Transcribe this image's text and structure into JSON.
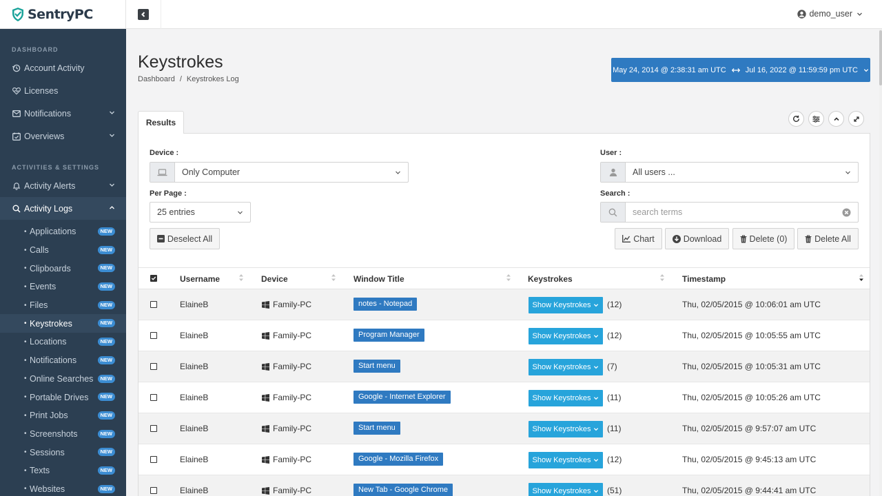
{
  "brand": {
    "name": "SentryPC",
    "shield_color": "#1aa39a"
  },
  "topbar": {
    "username": "demo_user"
  },
  "sidebar": {
    "sections": [
      {
        "heading": "DASHBOARD"
      },
      {
        "heading": "ACTIVITIES & SETTINGS"
      }
    ],
    "items": [
      {
        "label": "Account Activity",
        "icon": "history-icon"
      },
      {
        "label": "Licenses",
        "icon": "heart-pulse-icon"
      },
      {
        "label": "Notifications",
        "icon": "envelope-icon"
      },
      {
        "label": "Overviews",
        "icon": "calendar-check-icon"
      },
      {
        "label": "Activity Alerts",
        "icon": "bell-icon"
      },
      {
        "label": "Activity Logs",
        "icon": "search-icon"
      }
    ],
    "subitems": [
      {
        "label": "Applications",
        "badge": "NEW"
      },
      {
        "label": "Calls",
        "badge": "NEW"
      },
      {
        "label": "Clipboards",
        "badge": "NEW"
      },
      {
        "label": "Events",
        "badge": "NEW"
      },
      {
        "label": "Files",
        "badge": "NEW"
      },
      {
        "label": "Keystrokes",
        "badge": "NEW"
      },
      {
        "label": "Locations",
        "badge": "NEW"
      },
      {
        "label": "Notifications",
        "badge": "NEW"
      },
      {
        "label": "Online Searches",
        "badge": "NEW"
      },
      {
        "label": "Portable Drives",
        "badge": "NEW"
      },
      {
        "label": "Print Jobs",
        "badge": "NEW"
      },
      {
        "label": "Screenshots",
        "badge": "NEW"
      },
      {
        "label": "Sessions",
        "badge": "NEW"
      },
      {
        "label": "Texts",
        "badge": "NEW"
      },
      {
        "label": "Websites",
        "badge": "NEW"
      }
    ]
  },
  "page": {
    "title": "Keystrokes",
    "breadcrumb": [
      "Dashboard",
      "/",
      "Keystrokes Log"
    ],
    "date_range": {
      "start": "May 24, 2014 @ 2:38:31 am UTC",
      "end": "Jul 16, 2022 @ 11:59:59 pm UTC"
    },
    "tab": "Results"
  },
  "filters": {
    "device_label": "Device :",
    "device_value": "Only Computer",
    "user_label": "User :",
    "user_value": "All users ...",
    "perpage_label": "Per Page :",
    "perpage_value": "25 entries",
    "search_label": "Search :",
    "search_placeholder": "search terms"
  },
  "actions": {
    "deselect_all": "Deselect All",
    "chart": "Chart",
    "download": "Download",
    "delete": "Delete (0)",
    "delete_all": "Delete All"
  },
  "table": {
    "headers": [
      "Username",
      "Device",
      "Window Title",
      "Keystrokes",
      "Timestamp"
    ],
    "show_label": "Show Keystrokes",
    "rows": [
      {
        "username": "ElaineB",
        "device": "Family-PC",
        "window": "notes - Notepad",
        "count": "(12)",
        "timestamp": "Thu, 02/05/2015 @ 10:06:01 am UTC"
      },
      {
        "username": "ElaineB",
        "device": "Family-PC",
        "window": "Program Manager",
        "count": "(12)",
        "timestamp": "Thu, 02/05/2015 @ 10:05:55 am UTC"
      },
      {
        "username": "ElaineB",
        "device": "Family-PC",
        "window": "Start menu",
        "count": "(7)",
        "timestamp": "Thu, 02/05/2015 @ 10:05:31 am UTC"
      },
      {
        "username": "ElaineB",
        "device": "Family-PC",
        "window": "Google - Internet Explorer",
        "count": "(11)",
        "timestamp": "Thu, 02/05/2015 @ 10:05:26 am UTC"
      },
      {
        "username": "ElaineB",
        "device": "Family-PC",
        "window": "Start menu",
        "count": "(11)",
        "timestamp": "Thu, 02/05/2015 @ 9:57:07 am UTC"
      },
      {
        "username": "ElaineB",
        "device": "Family-PC",
        "window": "Google - Mozilla Firefox",
        "count": "(12)",
        "timestamp": "Thu, 02/05/2015 @ 9:45:13 am UTC"
      },
      {
        "username": "ElaineB",
        "device": "Family-PC",
        "window": "New Tab - Google Chrome",
        "count": "(51)",
        "timestamp": "Thu, 02/05/2015 @ 9:44:41 am UTC"
      }
    ]
  },
  "colors": {
    "sidebar_bg": "#2c3f52",
    "primary": "#2f7ac1",
    "show_button": "#27a4db",
    "badge": "#3c8dd3"
  }
}
